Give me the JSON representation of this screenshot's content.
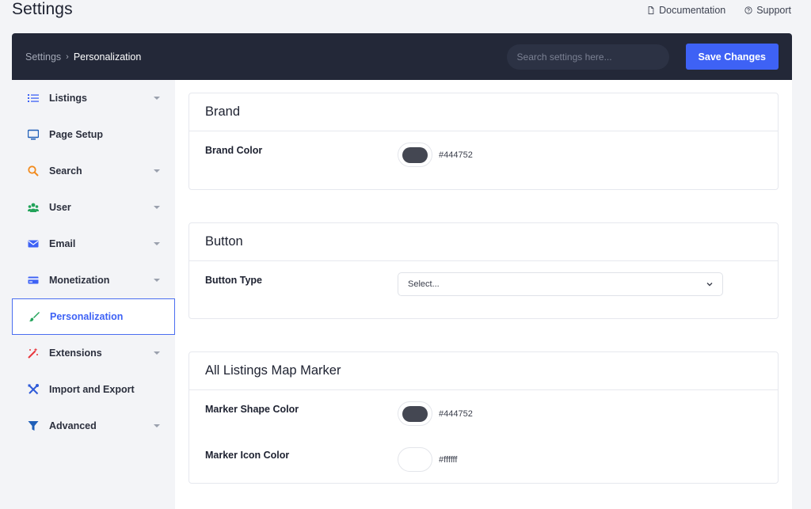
{
  "page": {
    "title": "Settings"
  },
  "top_links": [
    {
      "label": "Documentation",
      "icon": "document-icon"
    },
    {
      "label": "Support",
      "icon": "help-circle-icon"
    }
  ],
  "header": {
    "breadcrumb_root": "Settings",
    "breadcrumb_current": "Personalization",
    "search_placeholder": "Search settings here...",
    "save_label": "Save Changes"
  },
  "sidebar": {
    "items": [
      {
        "label": "Listings",
        "icon": "list-icon",
        "has_caret": true,
        "icon_color": "#3e62f5"
      },
      {
        "label": "Page Setup",
        "icon": "monitor-icon",
        "has_caret": false,
        "icon_color": "#1f5fb8"
      },
      {
        "label": "Search",
        "icon": "search-icon",
        "has_caret": true,
        "icon_color": "#f28a1c"
      },
      {
        "label": "User",
        "icon": "users-icon",
        "has_caret": true,
        "icon_color": "#22a35a"
      },
      {
        "label": "Email",
        "icon": "envelope-icon",
        "has_caret": true,
        "icon_color": "#3e62f5"
      },
      {
        "label": "Monetization",
        "icon": "card-icon",
        "has_caret": true,
        "icon_color": "#3e62f5"
      },
      {
        "label": "Personalization",
        "icon": "brush-icon",
        "has_caret": false,
        "icon_color": "#22a35a",
        "active": true
      },
      {
        "label": "Extensions",
        "icon": "magic-wand-icon",
        "has_caret": true,
        "icon_color": "#e8363d"
      },
      {
        "label": "Import and Export",
        "icon": "tools-icon",
        "has_caret": false,
        "icon_color": "#2f5bd8"
      },
      {
        "label": "Advanced",
        "icon": "filter-icon",
        "has_caret": true,
        "icon_color": "#1f5fb8"
      }
    ]
  },
  "sections": {
    "brand": {
      "title": "Brand",
      "brand_color_label": "Brand Color",
      "brand_color_value": "#444752"
    },
    "button": {
      "title": "Button",
      "button_type_label": "Button Type",
      "button_type_value": "Select..."
    },
    "map_marker": {
      "title": "All Listings Map Marker",
      "shape_color_label": "Marker Shape Color",
      "shape_color_value": "#444752",
      "icon_color_label": "Marker Icon Color",
      "icon_color_value": "#ffffff"
    }
  }
}
